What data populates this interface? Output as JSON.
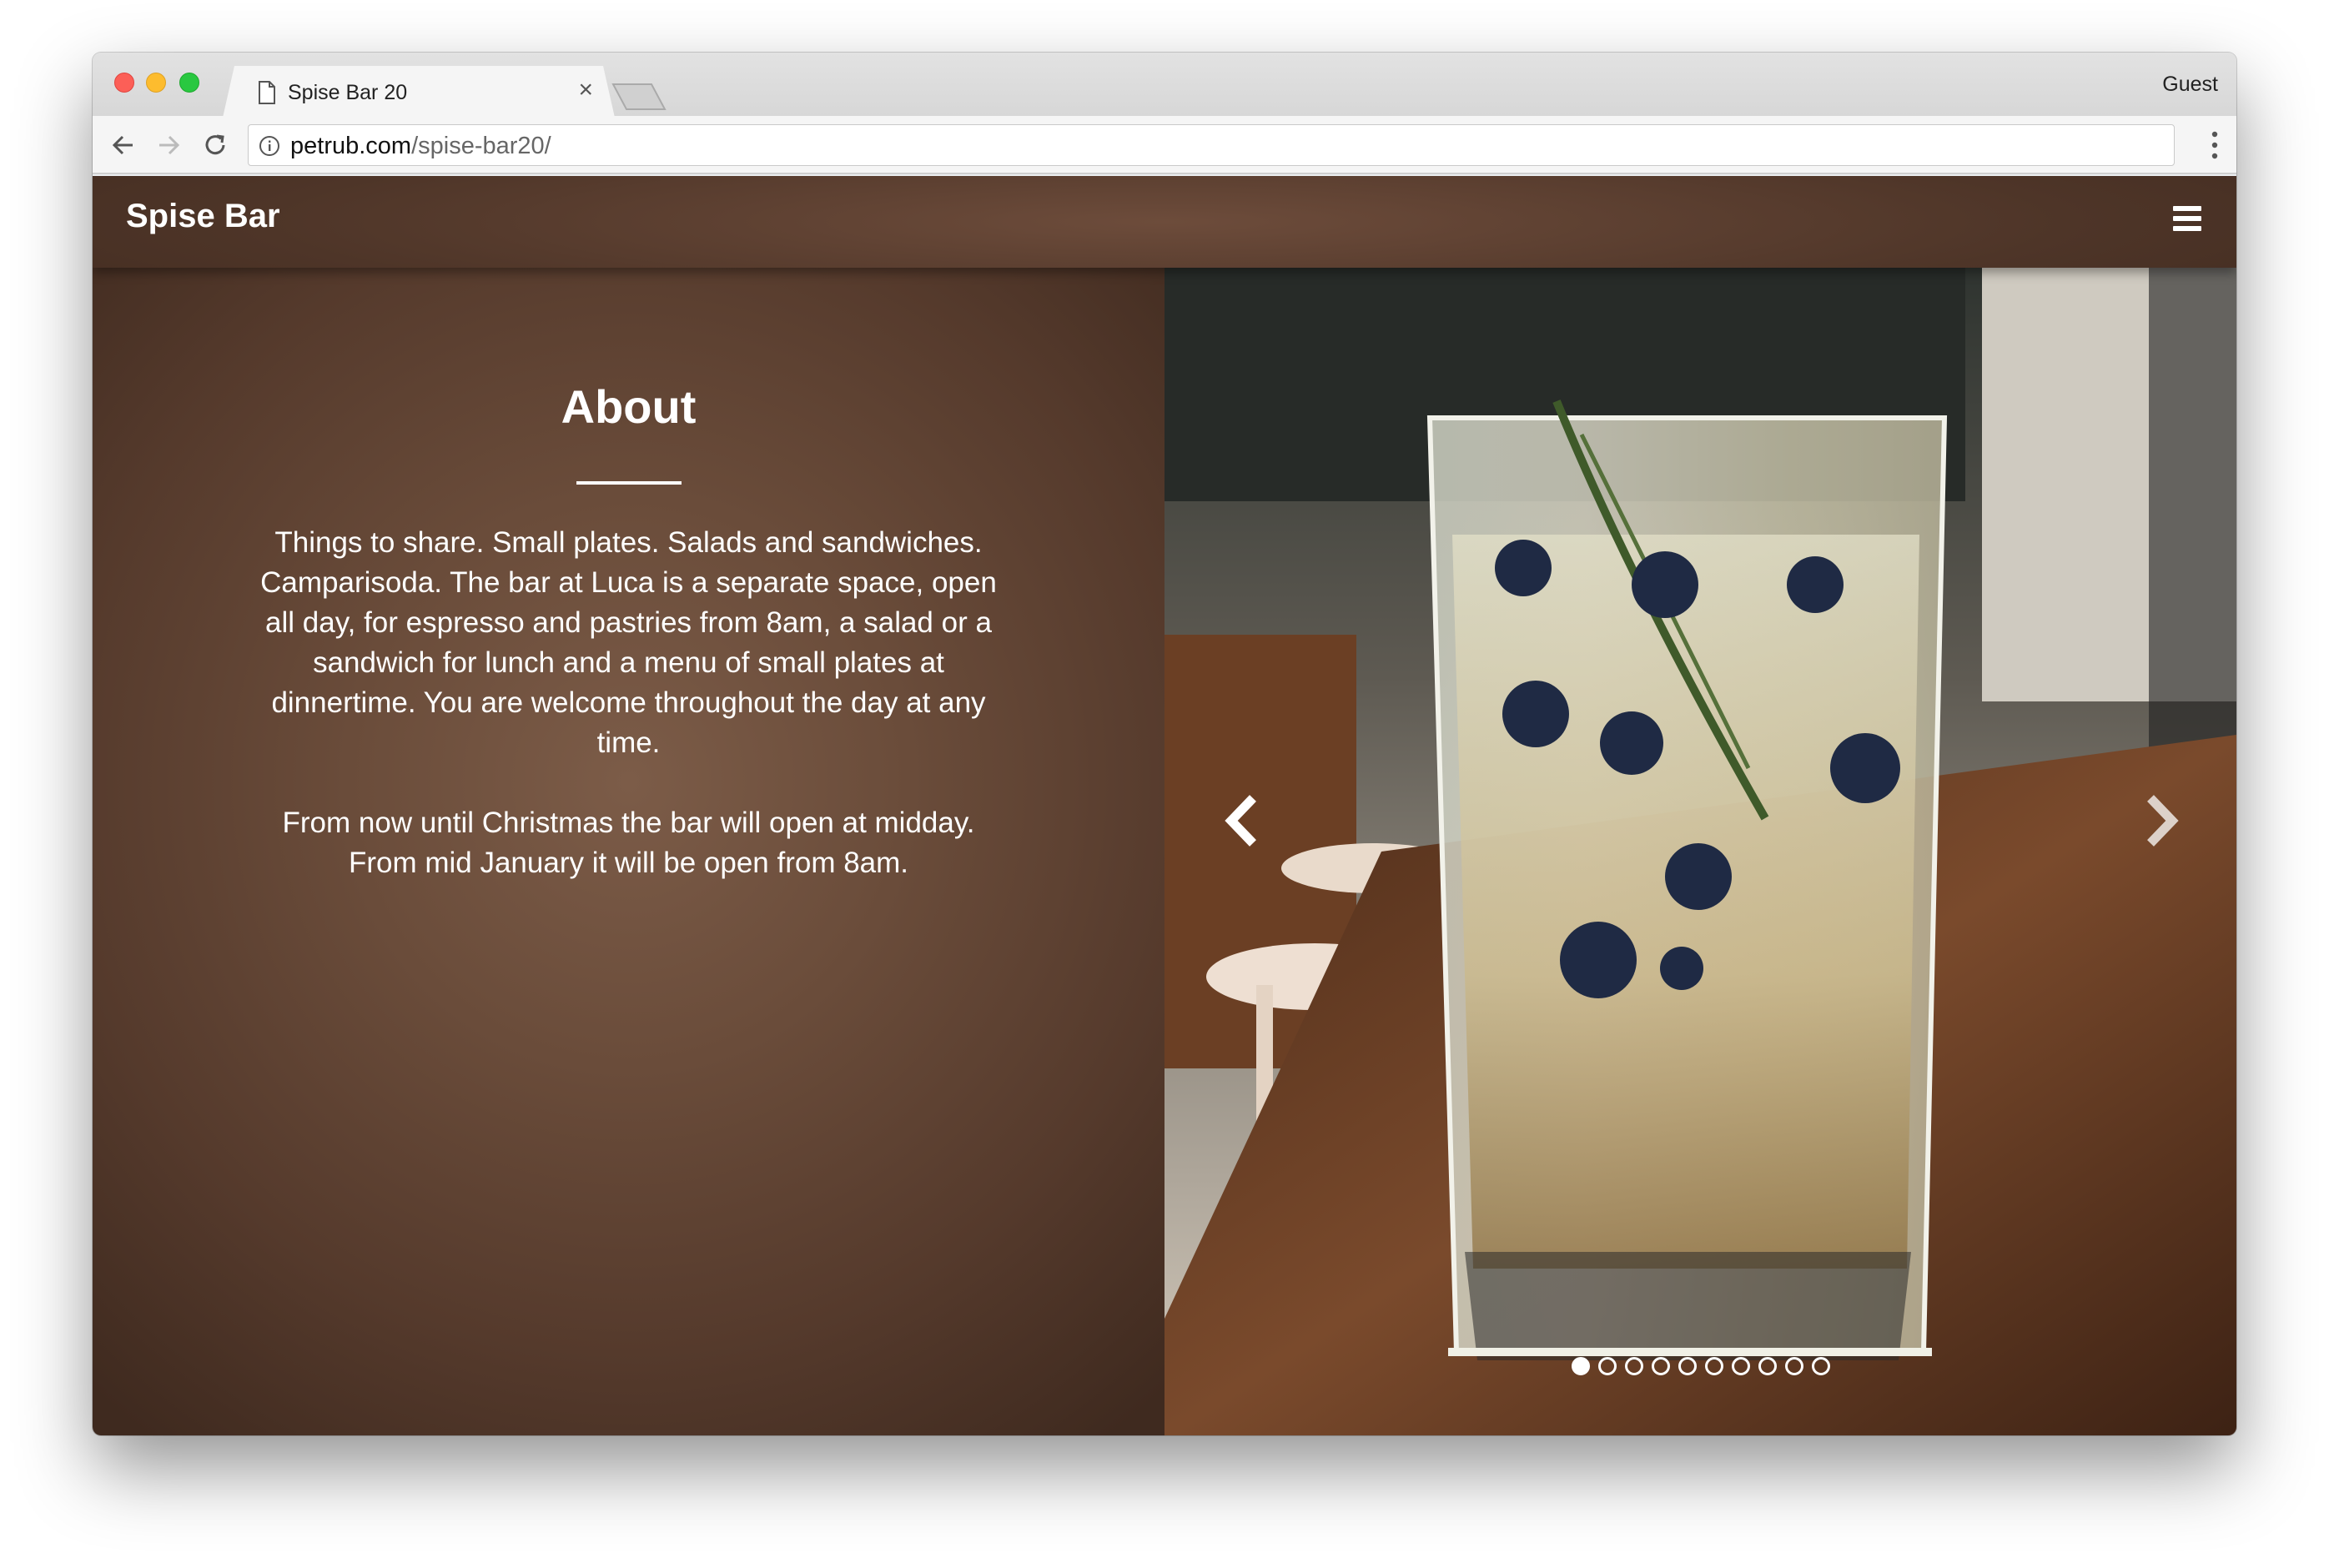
{
  "browser": {
    "tab_title": "Spise Bar 20",
    "tab_close": "×",
    "profile": "Guest",
    "url_host": "petrub.com",
    "url_path": "/spise-bar20/"
  },
  "site": {
    "brand": "Spise Bar"
  },
  "about": {
    "title": "About",
    "paragraphs": [
      "Things to share. Small plates. Salads and sandwiches. Camparisoda. The bar at Luca is a separate space, open all day, for espresso and pastries from 8am, a salad or a sandwich for lunch and a menu of small plates at dinnertime. You are welcome throughout the day at any time.",
      "From now until Christmas the bar will open at midday. From mid January it will be open from 8am."
    ]
  },
  "carousel": {
    "slide_count": 10,
    "active_index": 0
  },
  "colors": {
    "brown_dark": "#4e3528",
    "brown_mid": "#6d4c3b",
    "text": "#ffffff"
  }
}
